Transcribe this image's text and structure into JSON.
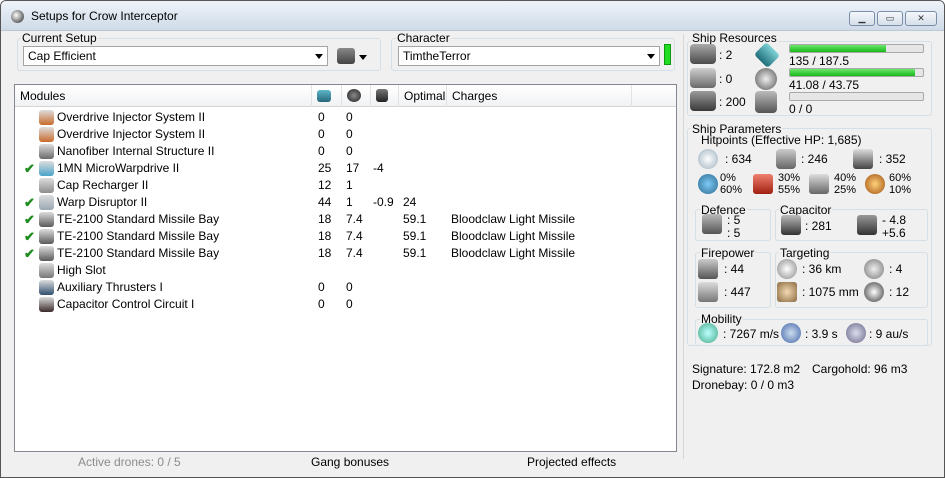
{
  "window": {
    "title": "Setups for Crow Interceptor"
  },
  "setup": {
    "label": "Current Setup",
    "value": "Cap Efficient"
  },
  "character": {
    "label": "Character",
    "value": "TimtheTerror"
  },
  "modules": {
    "columns": [
      "Modules",
      "Optimal",
      "Charges"
    ],
    "rows": [
      {
        "name": "Overdrive Injector System II",
        "active": false,
        "c1": "0",
        "c2": "0",
        "c3": "",
        "optimal": "",
        "charges": "",
        "color": "#c96a2a"
      },
      {
        "name": "Overdrive Injector System II",
        "active": false,
        "c1": "0",
        "c2": "0",
        "c3": "",
        "optimal": "",
        "charges": "",
        "color": "#c96a2a"
      },
      {
        "name": "Nanofiber Internal Structure II",
        "active": false,
        "c1": "0",
        "c2": "0",
        "c3": "",
        "optimal": "",
        "charges": "",
        "color": "#6a6a6a"
      },
      {
        "name": "1MN MicroWarpdrive II",
        "active": true,
        "c1": "25",
        "c2": "17",
        "c3": "-4",
        "optimal": "",
        "charges": "",
        "color": "#4aa3c9"
      },
      {
        "name": "Cap Recharger II",
        "active": false,
        "c1": "12",
        "c2": "1",
        "c3": "",
        "optimal": "",
        "charges": "",
        "color": "#8d8d8d"
      },
      {
        "name": "Warp Disruptor II",
        "active": true,
        "c1": "44",
        "c2": "1",
        "c3": "-0.9",
        "optimal": "24",
        "charges": "",
        "color": "#9aa7b3"
      },
      {
        "name": "TE-2100 Standard Missile Bay",
        "active": true,
        "c1": "18",
        "c2": "7.4",
        "c3": "",
        "optimal": "59.1",
        "charges": "Bloodclaw Light Missile",
        "color": "#5a5a5a"
      },
      {
        "name": "TE-2100 Standard Missile Bay",
        "active": true,
        "c1": "18",
        "c2": "7.4",
        "c3": "",
        "optimal": "59.1",
        "charges": "Bloodclaw Light Missile",
        "color": "#5a5a5a"
      },
      {
        "name": "TE-2100 Standard Missile Bay",
        "active": true,
        "c1": "18",
        "c2": "7.4",
        "c3": "",
        "optimal": "59.1",
        "charges": "Bloodclaw Light Missile",
        "color": "#5a5a5a"
      },
      {
        "name": "High Slot",
        "active": false,
        "c1": "",
        "c2": "",
        "c3": "",
        "optimal": "",
        "charges": "",
        "color": "#777777"
      },
      {
        "name": "Auxiliary Thrusters I",
        "active": false,
        "c1": "0",
        "c2": "0",
        "c3": "",
        "optimal": "",
        "charges": "",
        "color": "#2e4f6e"
      },
      {
        "name": "Capacitor Control Circuit I",
        "active": false,
        "c1": "0",
        "c2": "0",
        "c3": "",
        "optimal": "",
        "charges": "",
        "color": "#3a2a2a"
      }
    ]
  },
  "resources": {
    "label": "Ship Resources",
    "hardpoints": [
      {
        "value": ": 2"
      },
      {
        "value": ": 0"
      },
      {
        "value": ": 200"
      }
    ],
    "cpu": {
      "text": "135 / 187.5",
      "fraction": 0.72
    },
    "powergrid": {
      "text": "41.08 / 43.75",
      "fraction": 0.94
    },
    "calibration": {
      "text": "0 / 0",
      "fraction": 0
    }
  },
  "parameters": {
    "label": "Ship Parameters",
    "hitpoints_label": "Hitpoints (Effective HP: 1,685)",
    "shield": ": 634",
    "armor": ": 246",
    "structure": ": 352",
    "resists": [
      [
        "0%",
        "60%"
      ],
      [
        "30%",
        "55%"
      ],
      [
        "40%",
        "25%"
      ],
      [
        "60%",
        "10%"
      ]
    ]
  },
  "defence": {
    "label": "Defence",
    "v1": ": 5",
    "v2": ": 5"
  },
  "capacitor": {
    "label": "Capacitor",
    "amount": ": 281",
    "delta1": "- 4.8",
    "delta2": "+5.6"
  },
  "firepower": {
    "label": "Firepower",
    "v1": ": 44",
    "v2": ": 447"
  },
  "targeting": {
    "label": "Targeting",
    "range": ": 36 km",
    "targets": ": 4",
    "scan": ": 1075 mm",
    "sensor": ": 12"
  },
  "mobility": {
    "label": "Mobility",
    "speed": ": 7267 m/s",
    "align": ": 3.9 s",
    "warp": ": 9 au/s"
  },
  "misc": {
    "signature": "Signature: 172.8 m2",
    "cargohold": "Cargohold: 96 m3",
    "dronebay": "Dronebay: 0 / 0 m3"
  },
  "bottom": {
    "drones": "Active drones: 0 / 5",
    "gang": "Gang bonuses",
    "projected": "Projected effects"
  },
  "icons": [
    "app-icon",
    "minimize-icon",
    "maximize-icon",
    "close-icon",
    "ship-icon",
    "cpu-icon",
    "power-icon",
    "calibration-icon"
  ]
}
